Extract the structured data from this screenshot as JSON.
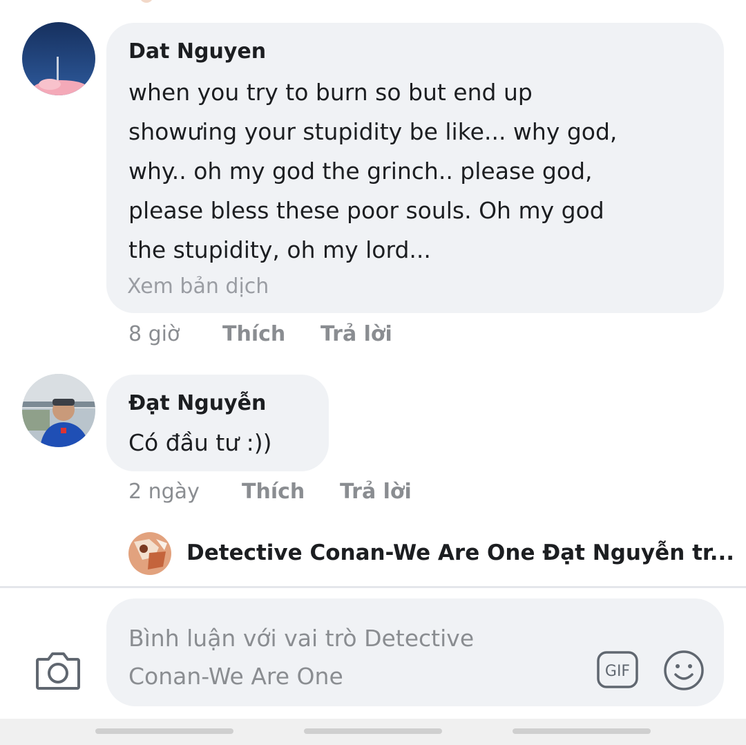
{
  "comments": [
    {
      "author": "Dat Nguyen",
      "lines": [
        "when you try to burn so but end up",
        "showưing your stupidity be like... why god,",
        "why.. oh my god the grinch.. please god,",
        "please bless these poor souls. Oh my god",
        "the stupidity, oh my lord..."
      ],
      "translate_label": "Xem bản dịch",
      "time": "8 giờ",
      "like_label": "Thích",
      "reply_label": "Trả lời"
    },
    {
      "author": "Đạt Nguyễn",
      "lines": [
        "Có đầu tư :))"
      ],
      "time": "2 ngày",
      "like_label": "Thích",
      "reply_label": "Trả lời"
    }
  ],
  "page_reply_preview": {
    "text": "Detective Conan-We Are One Đạt Nguyễn tr..."
  },
  "composer": {
    "placeholder_line1": "Bình luận với vai trò Detective",
    "placeholder_line2": "Conan-We Are One",
    "gif_label": "GIF"
  },
  "icons": {
    "camera": "camera-icon",
    "gif": "gif-icon",
    "emoji": "smiley-icon"
  },
  "colors": {
    "bubble": "#f0f2f5",
    "meta_text": "#8a8d91",
    "text": "#1c1e21"
  }
}
